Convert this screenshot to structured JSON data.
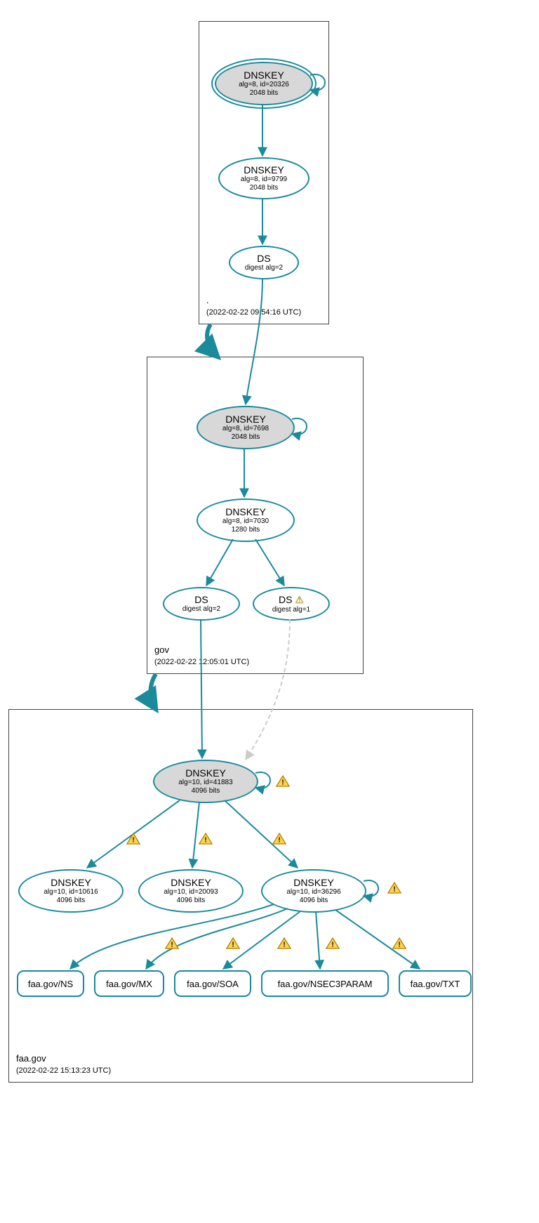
{
  "zones": {
    "root": {
      "label": ".",
      "timestamp": "(2022-02-22 09:54:16 UTC)"
    },
    "gov": {
      "label": "gov",
      "timestamp": "(2022-02-22 12:05:01 UTC)"
    },
    "faa": {
      "label": "faa.gov",
      "timestamp": "(2022-02-22 15:13:23 UTC)"
    }
  },
  "nodes": {
    "root_ksk": {
      "title": "DNSKEY",
      "sub1": "alg=8, id=20326",
      "sub2": "2048 bits"
    },
    "root_zsk": {
      "title": "DNSKEY",
      "sub1": "alg=8, id=9799",
      "sub2": "2048 bits"
    },
    "root_ds": {
      "title": "DS",
      "sub1": "digest alg=2"
    },
    "gov_ksk": {
      "title": "DNSKEY",
      "sub1": "alg=8, id=7698",
      "sub2": "2048 bits"
    },
    "gov_zsk": {
      "title": "DNSKEY",
      "sub1": "alg=8, id=7030",
      "sub2": "1280 bits"
    },
    "gov_ds1": {
      "title": "DS",
      "sub1": "digest alg=2"
    },
    "gov_ds2": {
      "title": "DS",
      "warn": "⚠",
      "sub1": "digest alg=1"
    },
    "faa_ksk": {
      "title": "DNSKEY",
      "sub1": "alg=10, id=41883",
      "sub2": "4096 bits"
    },
    "faa_zsk1": {
      "title": "DNSKEY",
      "sub1": "alg=10, id=10616",
      "sub2": "4096 bits"
    },
    "faa_zsk2": {
      "title": "DNSKEY",
      "sub1": "alg=10, id=20093",
      "sub2": "4096 bits"
    },
    "faa_zsk3": {
      "title": "DNSKEY",
      "sub1": "alg=10, id=36296",
      "sub2": "4096 bits"
    },
    "rr_ns": {
      "label": "faa.gov/NS"
    },
    "rr_mx": {
      "label": "faa.gov/MX"
    },
    "rr_soa": {
      "label": "faa.gov/SOA"
    },
    "rr_nsec3": {
      "label": "faa.gov/NSEC3PARAM"
    },
    "rr_txt": {
      "label": "faa.gov/TXT"
    }
  }
}
